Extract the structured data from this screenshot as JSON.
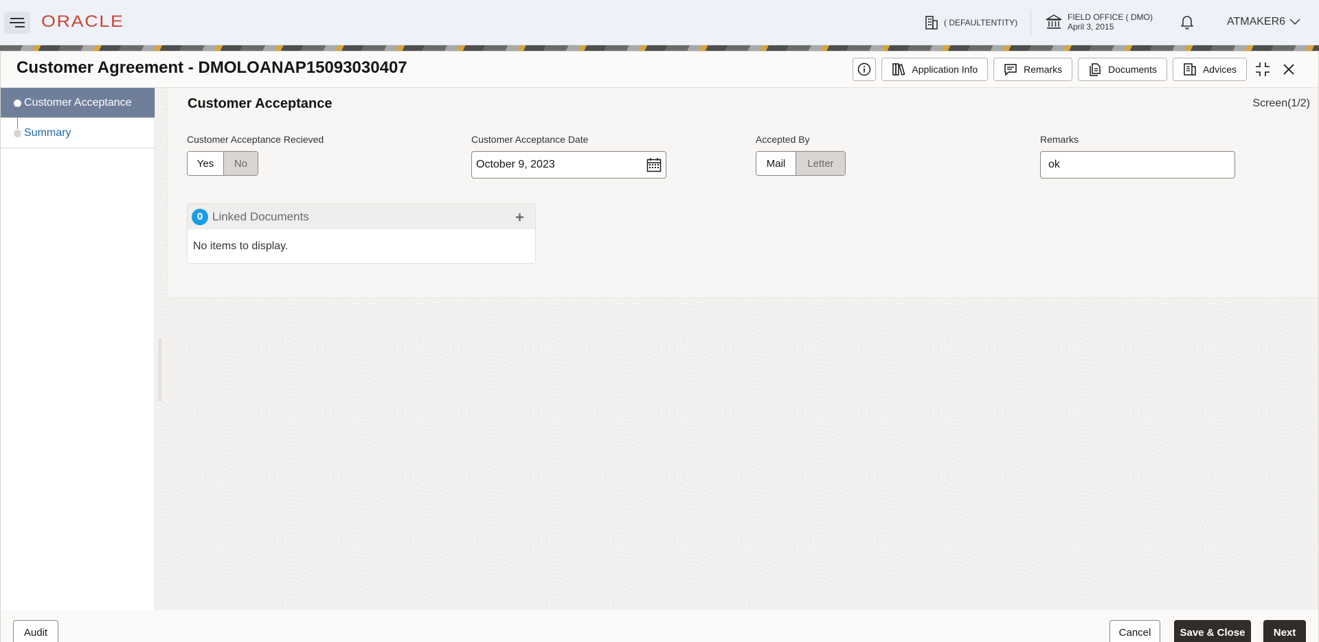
{
  "header": {
    "logo": "ORACLE",
    "entity": "( DEFAULTENTITY)",
    "office_name": "FIELD OFFICE ( DMO)",
    "office_date": "April 3, 2015",
    "user": "ATMAKER6"
  },
  "window": {
    "title": "Customer Agreement - DMOLOANAP15093030407",
    "toolbar": {
      "application_info": "Application Info",
      "remarks": "Remarks",
      "documents": "Documents",
      "advices": "Advices"
    }
  },
  "nav": {
    "items": [
      {
        "label": "Customer Acceptance",
        "active": true
      },
      {
        "label": "Summary",
        "active": false
      }
    ]
  },
  "section": {
    "title": "Customer Acceptance",
    "screen": "Screen(1/2)",
    "fields": {
      "received": {
        "label": "Customer Acceptance Recieved",
        "options": [
          "Yes",
          "No"
        ],
        "selected": "Yes"
      },
      "date": {
        "label": "Customer Acceptance Date",
        "value": "October 9, 2023"
      },
      "accepted_by": {
        "label": "Accepted By",
        "options": [
          "Mail",
          "Letter"
        ],
        "selected": "Mail"
      },
      "remarks": {
        "label": "Remarks",
        "value": "ok"
      }
    },
    "linked_documents": {
      "count": "0",
      "title": "Linked Documents",
      "empty": "No items to display."
    }
  },
  "footer": {
    "audit": "Audit",
    "cancel": "Cancel",
    "save_close": "Save & Close",
    "next": "Next"
  },
  "colors": {
    "oracle_red": "#c74634",
    "nav_active": "#6f7f99",
    "badge_blue": "#1b9ce5",
    "dark_button": "#312d2a"
  }
}
